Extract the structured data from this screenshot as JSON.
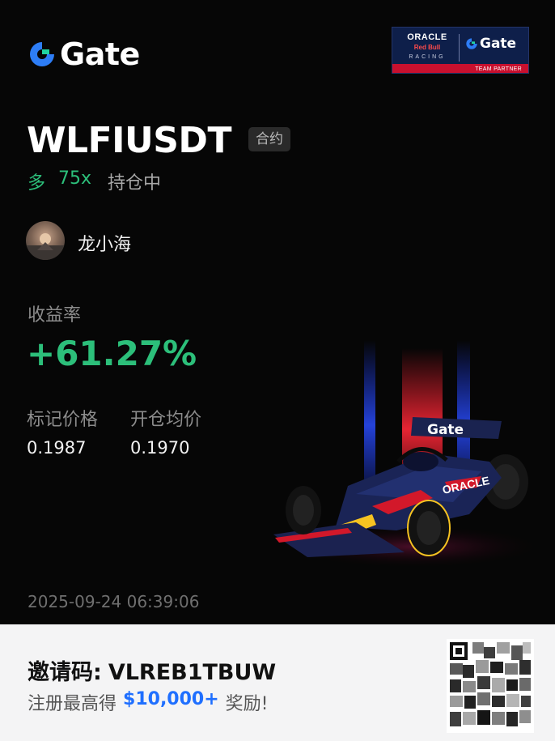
{
  "brand": {
    "logo_text": "Gate",
    "partner_badge": {
      "line1": "ORACLE",
      "line2": "Red Bull",
      "line3": "RACING",
      "gate_text": "Gate",
      "footer": "TEAM PARTNER"
    }
  },
  "position": {
    "pair": "WLFIUSDT",
    "contract_tag": "合约",
    "direction": "多",
    "leverage": "75x",
    "status": "持仓中"
  },
  "user": {
    "name": "龙小海"
  },
  "roi": {
    "label": "收益率",
    "value": "+61.27%"
  },
  "prices": {
    "mark_label": "标记价格",
    "mark_value": "0.1987",
    "entry_label": "开仓均价",
    "entry_value": "0.1970"
  },
  "timestamp": "2025-09-24 06:39:06",
  "footer": {
    "invite_label": "邀请码:",
    "invite_code": "VLREB1TBUW",
    "bonus_prefix": "注册最高得",
    "bonus_amount": "$10,000+",
    "bonus_suffix": "奖励!"
  },
  "colors": {
    "profit_green": "#2cbf7a",
    "brand_blue": "#1f6fff"
  }
}
